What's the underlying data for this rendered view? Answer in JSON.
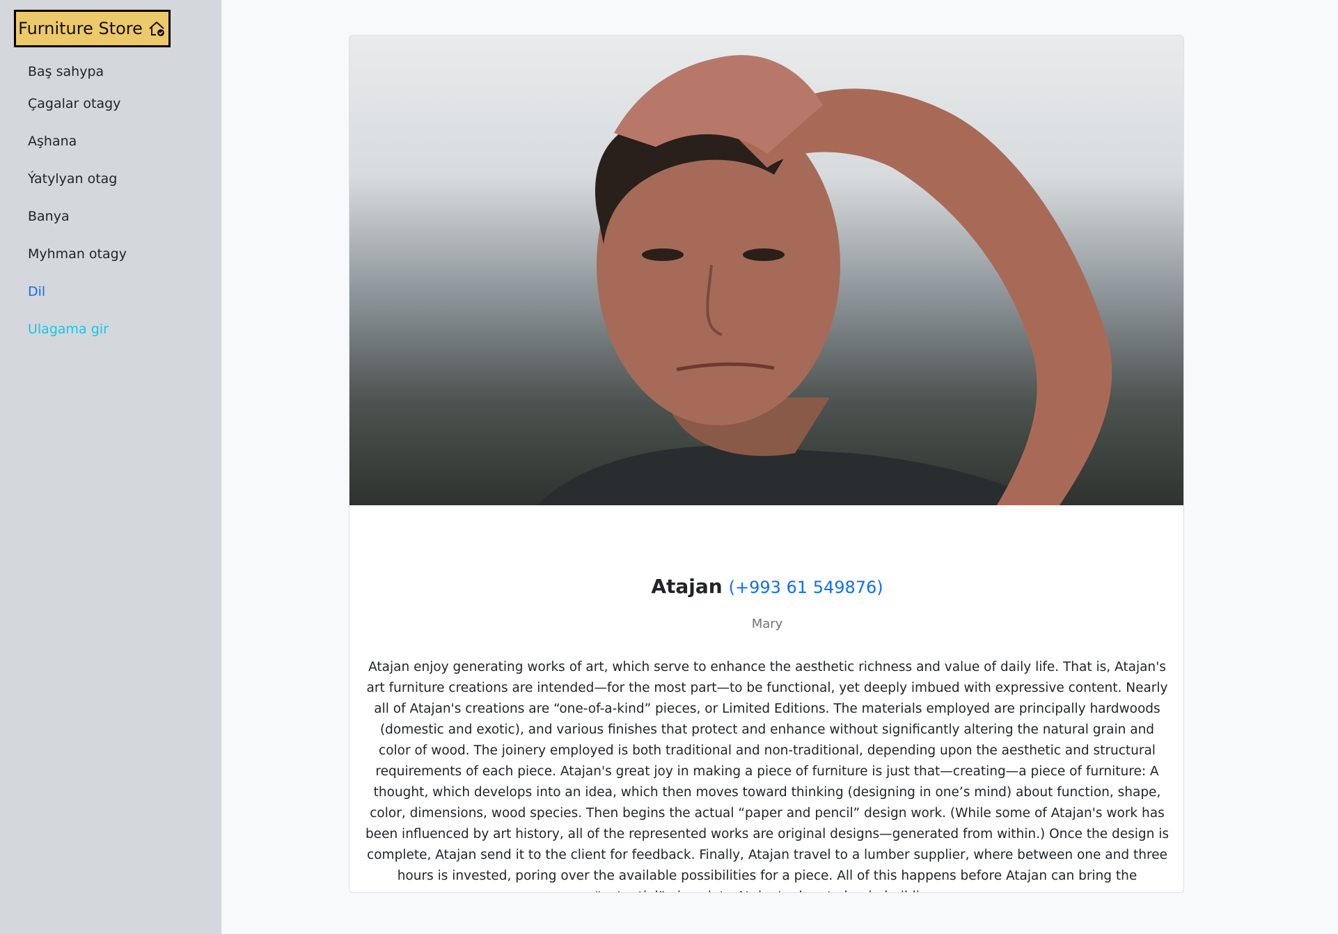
{
  "brand": {
    "label": "Furniture Store",
    "icon": "house-check-icon",
    "bg_color": "#ecc96a"
  },
  "sidebar": {
    "items": [
      {
        "label": "Baş sahypa"
      },
      {
        "label": "Çagalar otagy"
      },
      {
        "label": "Aşhana"
      },
      {
        "label": "Ýatylyan otag"
      },
      {
        "label": "Banya"
      },
      {
        "label": "Myhman otagy"
      },
      {
        "label": "Dil"
      },
      {
        "label": "Ulagama gir"
      }
    ],
    "link_color": "#0d6efd",
    "contact_color": "#0dcaf0"
  },
  "profile": {
    "name": "Atajan",
    "phone": "(+993 61 549876)",
    "city": "Mary",
    "bio": "Atajan enjoy generating works of art, which serve to enhance the aesthetic richness and value of daily life. That is, Atajan's art furniture creations are intended—for the most part—to be functional, yet deeply imbued with expressive content. Nearly all of Atajan's creations are “one-of-a-kind” pieces, or Limited Editions. The materials employed are principally hardwoods (domestic and exotic), and various finishes that protect and enhance without significantly altering the natural grain and color of wood. The joinery employed is both traditional and non-traditional, depending upon the aesthetic and structural requirements of each piece. Atajan's great joy in making a piece of furniture is just that—creating—a piece of furniture: A thought, which develops into an idea, which then moves toward thinking (designing in one’s mind) about function, shape, color, dimensions, wood species. Then begins the actual “paper and pencil” design work. (While some of Atajan's work has been influenced by art history, all of the represented works are original designs—generated from within.) Once the design is complete, Atajan send it to the client for feedback. Finally, Atajan travel to a lumber supplier, where between one and three hours is invested, poring over the available possibilities for a piece. All of this happens before Atajan can bring the “potential” piece into Atajan's shop to begin building."
  }
}
